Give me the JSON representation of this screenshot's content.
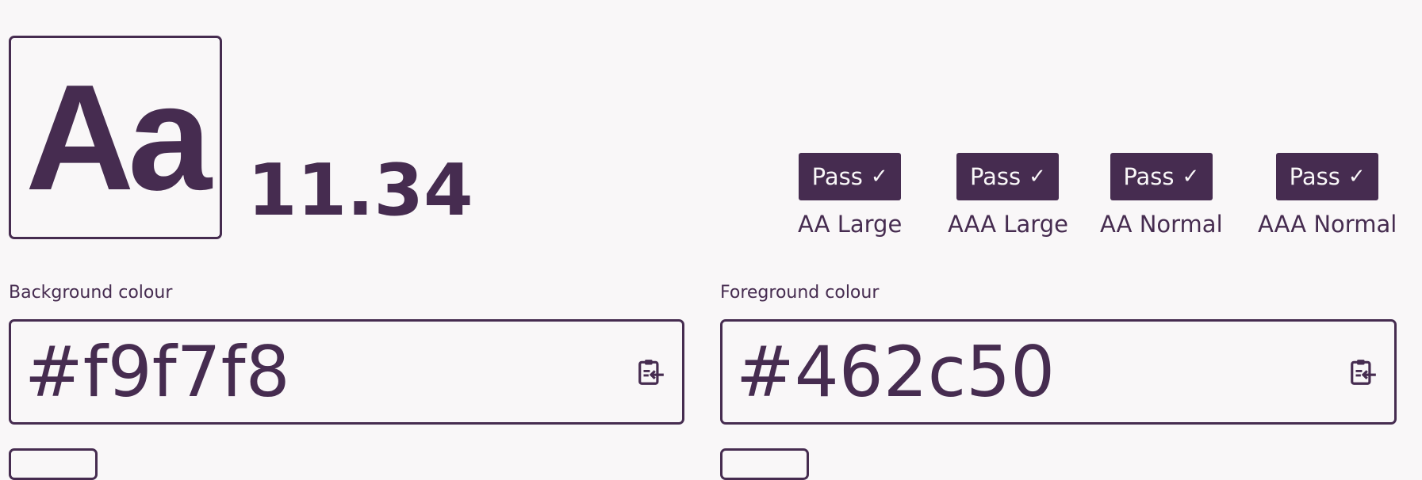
{
  "preview": {
    "sample_text": "Aa"
  },
  "contrast": {
    "ratio": "11.34"
  },
  "results": [
    {
      "status": "Pass",
      "label": "AA Large"
    },
    {
      "status": "Pass",
      "label": "AAA Large"
    },
    {
      "status": "Pass",
      "label": "AA Normal"
    },
    {
      "status": "Pass",
      "label": "AAA Normal"
    }
  ],
  "background": {
    "label": "Background colour",
    "value": "#f9f7f8"
  },
  "foreground": {
    "label": "Foreground colour",
    "value": "#462c50"
  },
  "icons": {
    "check": "check-icon",
    "paste": "clipboard-paste-icon"
  },
  "colors": {
    "page_background": "#f9f7f8",
    "accent": "#462c50"
  }
}
